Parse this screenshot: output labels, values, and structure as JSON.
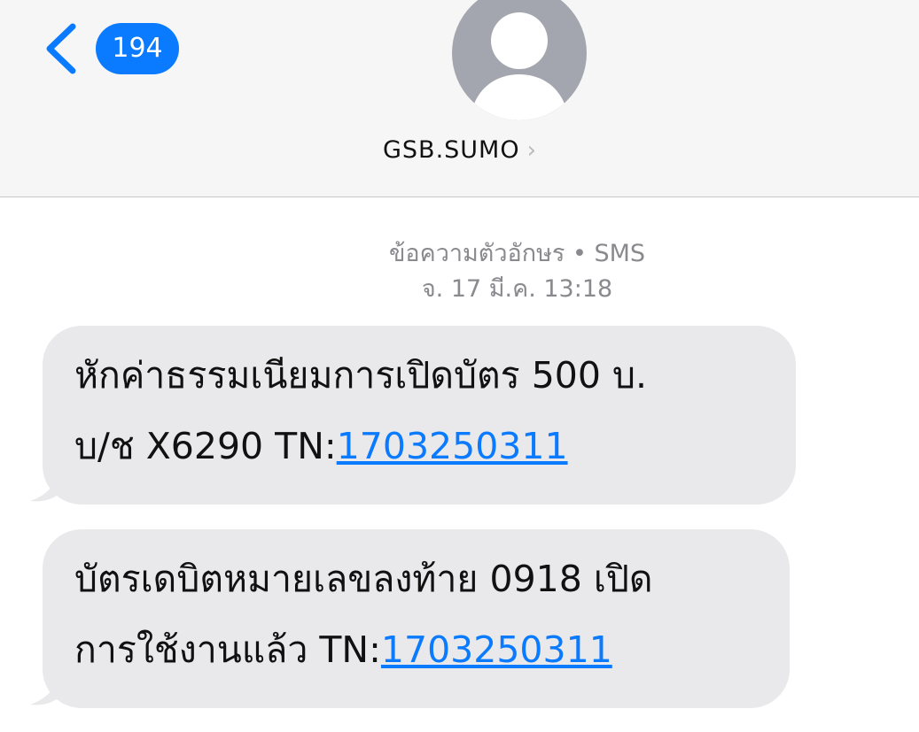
{
  "header": {
    "back_count": "194",
    "contact_name": "GSB.SUMO",
    "chevron": "›"
  },
  "thread": {
    "meta_label": "ข้อความตัวอักษร • SMS",
    "meta_time": "จ. 17 มี.ค. 13:18"
  },
  "messages": [
    {
      "line1": "หักค่าธรรมเนียมการเปิดบัตร 500 บ.",
      "line2_prefix": "บ/ช X6290 TN:",
      "link": "1703250311"
    },
    {
      "line1": "บัตรเดบิตหมายเลขลงท้าย 0918 เปิด",
      "line2_prefix": "การใช้งานแล้ว TN:",
      "link": "1703250311"
    }
  ],
  "icons": {
    "back": "chevron-left-icon",
    "avatar": "person-icon",
    "contact_chevron": "chevron-right-icon"
  },
  "colors": {
    "accent": "#0a7aff",
    "bubble": "#e9e9eb",
    "header_bg": "#f6f6f6",
    "meta_text": "#8a8a8e",
    "avatar": "#a3a6ae"
  }
}
